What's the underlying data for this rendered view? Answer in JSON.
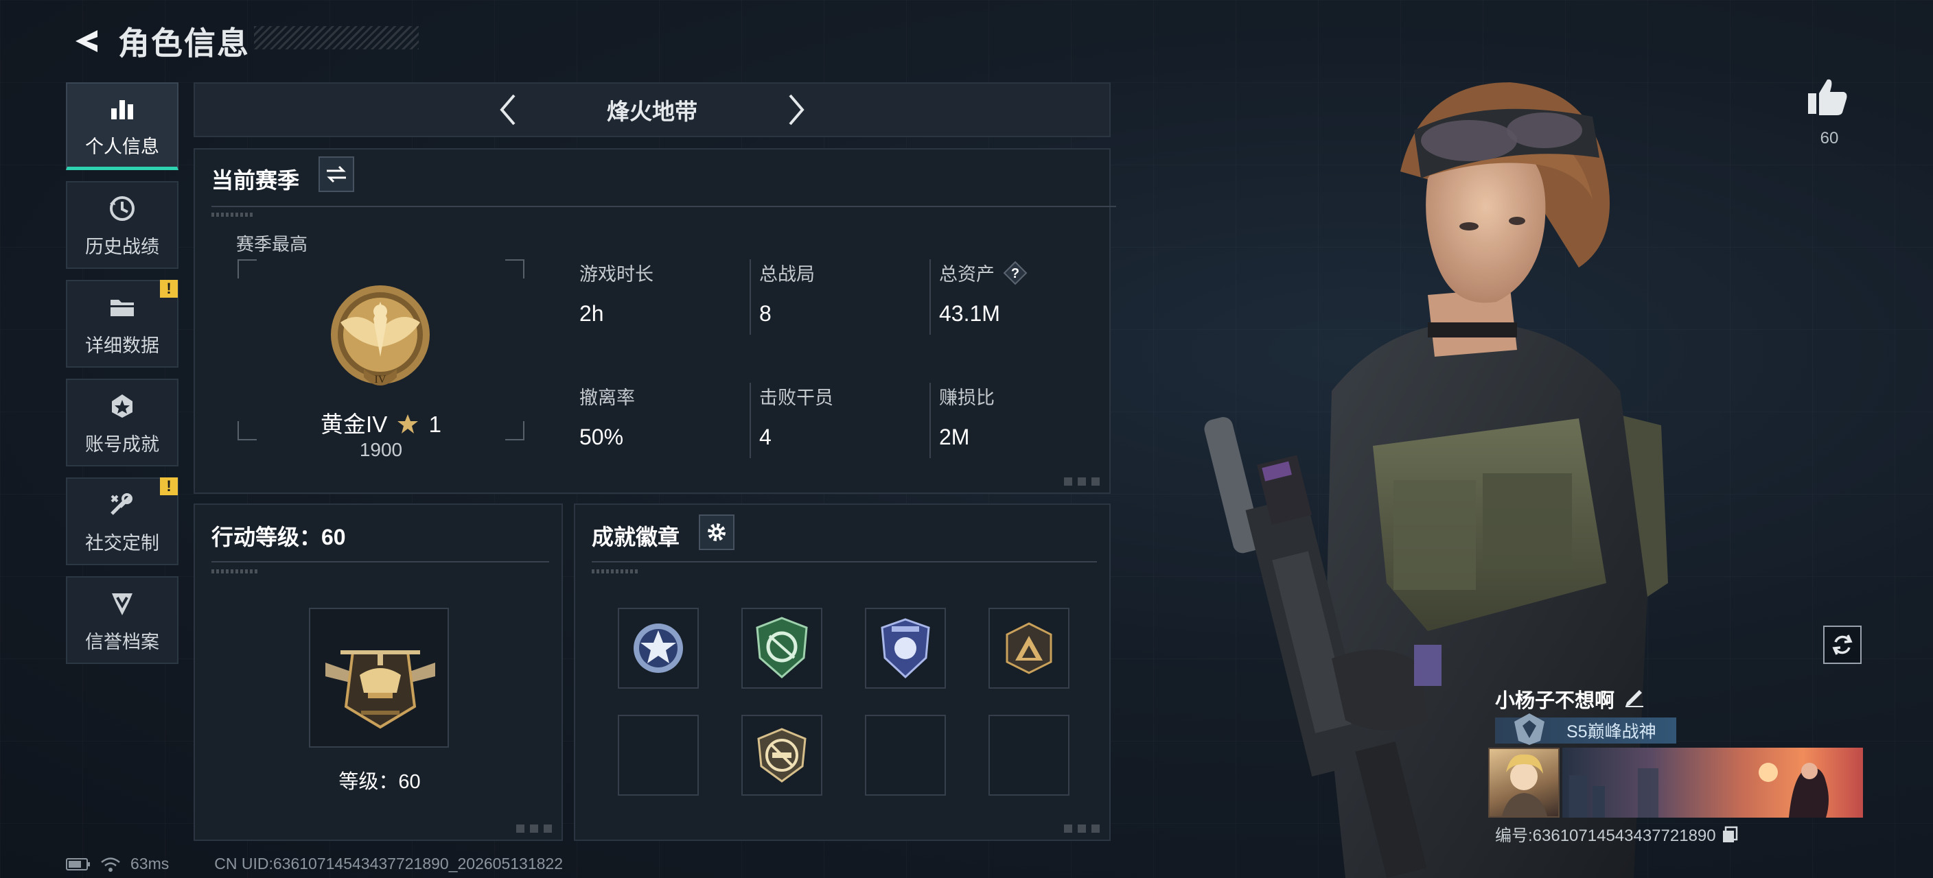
{
  "header": {
    "title": "角色信息"
  },
  "sidebar": {
    "items": [
      {
        "label": "个人信息",
        "icon": "bar-chart-icon",
        "active": true,
        "alert": false
      },
      {
        "label": "历史战绩",
        "icon": "history-clock-icon",
        "active": false,
        "alert": false
      },
      {
        "label": "详细数据",
        "icon": "folder-icon",
        "active": false,
        "alert": true
      },
      {
        "label": "账号成就",
        "icon": "achievement-icon",
        "active": false,
        "alert": false
      },
      {
        "label": "社交定制",
        "icon": "wrench-icon",
        "active": false,
        "alert": true
      },
      {
        "label": "信誉档案",
        "icon": "credit-shield-icon",
        "active": false,
        "alert": false
      }
    ],
    "alert_mark": "!"
  },
  "mode": {
    "title": "烽火地带"
  },
  "season": {
    "title": "当前赛季",
    "high_label": "赛季最高",
    "rank_name": "黄金IV",
    "rank_stars": "1",
    "rank_score": "1900",
    "rank_numeral": "IV",
    "stats": [
      {
        "label": "游戏时长",
        "value": "2h"
      },
      {
        "label": "总战局",
        "value": "8"
      },
      {
        "label": "总资产",
        "value": "43.1M",
        "help": "?"
      },
      {
        "label": "撤离率",
        "value": "50%"
      },
      {
        "label": "击败干员",
        "value": "4"
      },
      {
        "label": "赚损比",
        "value": "2M"
      }
    ]
  },
  "action_level": {
    "title": "行动等级：60",
    "level_text": "等级：60"
  },
  "achievements": {
    "title": "成就徽章"
  },
  "profile": {
    "likes": "60",
    "player_name": "小杨子不想啊",
    "title_text": "S5巅峰战神",
    "uid": "编号:6361071454343​7721890"
  },
  "footer": {
    "ping": "63ms",
    "server_uid": "CN UID:636107145434377​21890_202605131822"
  },
  "colors": {
    "accent": "#2fd2b0",
    "alert": "#f0c23a",
    "gold": "#c9a15a"
  }
}
